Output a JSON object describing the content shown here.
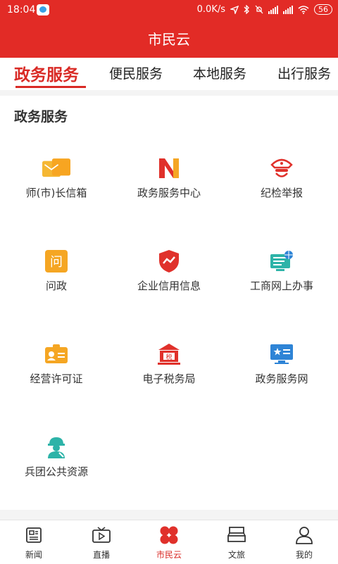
{
  "status_bar": {
    "time": "18:04",
    "speed": "0.0K/s",
    "network": "4G",
    "battery": "56"
  },
  "header": {
    "title": "市民云"
  },
  "tabs": [
    {
      "label": "政务服务",
      "active": true
    },
    {
      "label": "便民服务"
    },
    {
      "label": "本地服务"
    },
    {
      "label": "出行服务"
    }
  ],
  "section": {
    "title": "政务服务"
  },
  "services": [
    {
      "label": "师(市)长信箱",
      "icon": "mailbox-icon",
      "color": "#f5a623"
    },
    {
      "label": "政务服务中心",
      "icon": "gov-service-center-icon",
      "color": "#e0312b"
    },
    {
      "label": "纪检举报",
      "icon": "police-cap-icon",
      "color": "#e0312b"
    },
    {
      "label": "问政",
      "icon": "inquiry-icon",
      "color": "#f5a623"
    },
    {
      "label": "企业信用信息",
      "icon": "shield-chart-icon",
      "color": "#e0312b"
    },
    {
      "label": "工商网上办事",
      "icon": "online-office-icon",
      "color": "#2db3a8"
    },
    {
      "label": "经营许可证",
      "icon": "license-card-icon",
      "color": "#f5a623"
    },
    {
      "label": "电子税务局",
      "icon": "tax-bureau-icon",
      "color": "#e0312b"
    },
    {
      "label": "政务服务网",
      "icon": "monitor-star-icon",
      "color": "#2e84d6"
    },
    {
      "label": "兵团公共资源",
      "icon": "worker-icon",
      "color": "#2db3a8"
    }
  ],
  "bottom_nav": [
    {
      "label": "新闻",
      "icon": "news-icon"
    },
    {
      "label": "直播",
      "icon": "tv-icon"
    },
    {
      "label": "市民云",
      "icon": "clover-icon",
      "active": true
    },
    {
      "label": "文旅",
      "icon": "culture-icon"
    },
    {
      "label": "我的",
      "icon": "user-icon"
    }
  ]
}
